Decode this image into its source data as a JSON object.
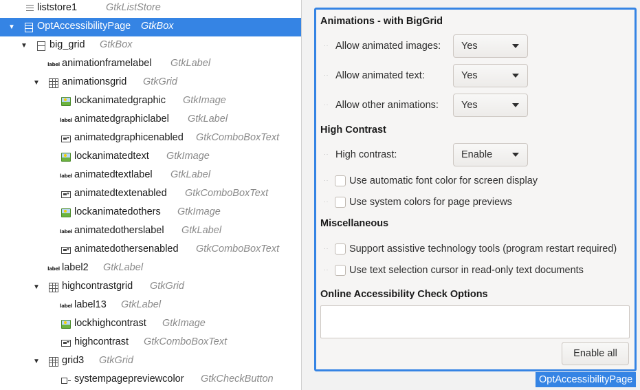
{
  "tree": {
    "rows": [
      {
        "name": "liststore1",
        "type": "GtkListStore",
        "icon": "list-icon",
        "expander": "none",
        "selected": false
      },
      {
        "name": "OptAccessibilityPage",
        "type": "GtkBox",
        "icon": "box-icon",
        "expander": "expanded",
        "selected": true
      },
      {
        "name": "big_grid",
        "type": "GtkBox",
        "icon": "box-icon",
        "expander": "expanded",
        "selected": false
      },
      {
        "name": "animationframelabel",
        "type": "GtkLabel",
        "icon": "label-icon",
        "expander": "none",
        "selected": false
      },
      {
        "name": "animationsgrid",
        "type": "GtkGrid",
        "icon": "grid-icon",
        "expander": "expanded",
        "selected": false
      },
      {
        "name": "lockanimatedgraphic",
        "type": "GtkImage",
        "icon": "image-icon",
        "expander": "none",
        "selected": false
      },
      {
        "name": "animatedgraphiclabel",
        "type": "GtkLabel",
        "icon": "label-icon",
        "expander": "none",
        "selected": false
      },
      {
        "name": "animatedgraphicenabled",
        "type": "GtkComboBoxText",
        "icon": "combo-icon",
        "expander": "none",
        "selected": false
      },
      {
        "name": "lockanimatedtext",
        "type": "GtkImage",
        "icon": "image-icon",
        "expander": "none",
        "selected": false
      },
      {
        "name": "animatedtextlabel",
        "type": "GtkLabel",
        "icon": "label-icon",
        "expander": "none",
        "selected": false
      },
      {
        "name": "animatedtextenabled",
        "type": "GtkComboBoxText",
        "icon": "combo-icon",
        "expander": "none",
        "selected": false
      },
      {
        "name": "lockanimatedothers",
        "type": "GtkImage",
        "icon": "image-icon",
        "expander": "none",
        "selected": false
      },
      {
        "name": "animatedotherslabel",
        "type": "GtkLabel",
        "icon": "label-icon",
        "expander": "none",
        "selected": false
      },
      {
        "name": "animatedothersenabled",
        "type": "GtkComboBoxText",
        "icon": "combo-icon",
        "expander": "none",
        "selected": false
      },
      {
        "name": "label2",
        "type": "GtkLabel",
        "icon": "label-icon",
        "expander": "none",
        "selected": false
      },
      {
        "name": "highcontrastgrid",
        "type": "GtkGrid",
        "icon": "grid-icon",
        "expander": "expanded",
        "selected": false
      },
      {
        "name": "label13",
        "type": "GtkLabel",
        "icon": "label-icon",
        "expander": "none",
        "selected": false
      },
      {
        "name": "lockhighcontrast",
        "type": "GtkImage",
        "icon": "image-icon",
        "expander": "none",
        "selected": false
      },
      {
        "name": "highcontrast",
        "type": "GtkComboBoxText",
        "icon": "combo-icon",
        "expander": "none",
        "selected": false
      },
      {
        "name": "grid3",
        "type": "GtkGrid",
        "icon": "grid-icon",
        "expander": "expanded",
        "selected": false
      },
      {
        "name": "systempagepreviewcolor",
        "type": "GtkCheckButton",
        "icon": "checkbutton-icon",
        "expander": "none",
        "selected": false
      }
    ],
    "label_icon_text": "label"
  },
  "preview": {
    "animations": {
      "title": "Animations - with BigGrid",
      "images_label": "Allow animated images:",
      "images_value": "Yes",
      "text_label": "Allow animated text:",
      "text_value": "Yes",
      "others_label": "Allow other animations:",
      "others_value": "Yes"
    },
    "high_contrast": {
      "title": "High Contrast",
      "contrast_label": "High contrast:",
      "contrast_value": "Enable",
      "auto_font_color": "Use automatic font color for screen display",
      "system_colors": "Use system colors for page previews"
    },
    "misc": {
      "title": "Miscellaneous",
      "assistive_tools": "Support assistive technology tools (program restart required)",
      "text_cursor": "Use text selection cursor in read-only text documents"
    },
    "online_check": {
      "title": "Online Accessibility Check Options",
      "enable_all": "Enable all"
    },
    "page_tag": "OptAccessibilityPage"
  },
  "colors": {
    "selection": "#3584e4",
    "type_text": "#8a8a8a"
  }
}
